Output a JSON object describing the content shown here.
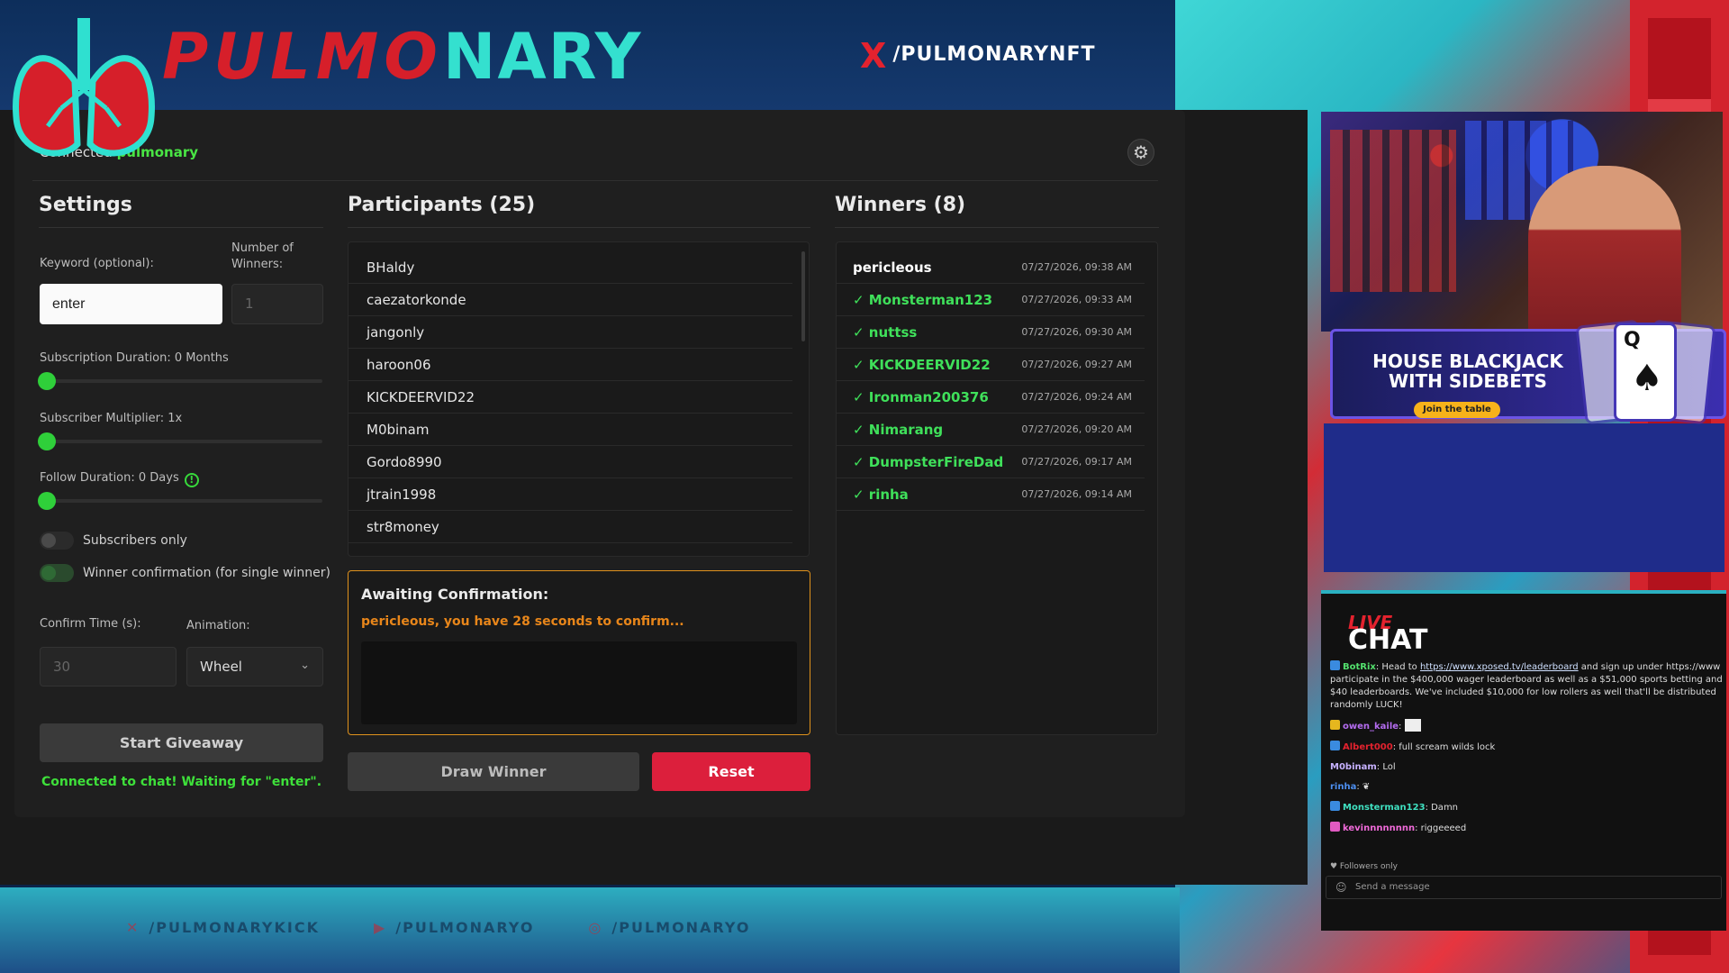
{
  "brand": {
    "part1": "PULMO",
    "part2": "NARY",
    "x_handle": "/PULMONARYNFT"
  },
  "socials": [
    "/PULMONARYKICK",
    "/PULMONARYO",
    "/PULMONARYO"
  ],
  "header": {
    "connected_label": "Connected",
    "channel_name": "pulmonary"
  },
  "settings": {
    "title": "Settings",
    "keyword_label": "Keyword (optional):",
    "keyword_value": "enter",
    "num_winners_label_1": "Number of",
    "num_winners_label_2": "Winners:",
    "num_winners_value": "1",
    "sub_duration_label": "Subscription Duration: 0 Months",
    "sub_multiplier_label": "Subscriber Multiplier: 1x",
    "follow_duration_label": "Follow Duration:  0  Days",
    "subscribers_only_label": "Subscribers only",
    "winner_confirmation_label": "Winner confirmation (for single winner)",
    "confirm_time_label": "Confirm Time (s):",
    "confirm_time_value": "30",
    "animation_label": "Animation:",
    "animation_value": "Wheel",
    "start_label": "Start Giveaway",
    "status_text": "Connected to chat! Waiting for \"enter\"."
  },
  "participants": {
    "title": "Participants (25)",
    "items": [
      "BHaldy",
      "caezatorkonde",
      "jangonly",
      "haroon06",
      "KICKDEERVID22",
      "M0binam",
      "Gordo8990",
      "jtrain1998",
      "str8money"
    ],
    "await_title": "Awaiting Confirmation:",
    "await_message": "pericleous, you have 28 seconds to confirm...",
    "draw_label": "Draw Winner",
    "reset_label": "Reset"
  },
  "winners": {
    "title": "Winners (8)",
    "items": [
      {
        "name": "pericleous",
        "time": "07/27/2026, 09:38 AM"
      },
      {
        "name": "✓ Monsterman123",
        "time": "07/27/2026, 09:33 AM"
      },
      {
        "name": "✓ nuttss",
        "time": "07/27/2026, 09:30 AM"
      },
      {
        "name": "✓ KICKDEERVID22",
        "time": "07/27/2026, 09:27 AM"
      },
      {
        "name": "✓ Ironman200376",
        "time": "07/27/2026, 09:24 AM"
      },
      {
        "name": "✓ Nimarang",
        "time": "07/27/2026, 09:20 AM"
      },
      {
        "name": "✓ DumpsterFireDad",
        "time": "07/27/2026, 09:17 AM"
      },
      {
        "name": "✓ rinha",
        "time": "07/27/2026, 09:14 AM"
      }
    ]
  },
  "promo": {
    "title": "HOUSE BLACKJACK WITH SIDEBETS",
    "button": "Join the table",
    "card_rank": "Q",
    "card_suit": "♠"
  },
  "chat": {
    "live": "LIVE",
    "chat": "CHAT",
    "m1_user": "BotRix",
    "m1_text_a": ": Head to ",
    "m1_link": "https://www.xposed.tv/leaderboard",
    "m1_text_b": " and sign up under https://www",
    "m1_text_c": "participate in the $400,000 wager leaderboard as well as a $51,000 sports betting and $40 leaderboards. We've included $10,000 for low rollers as well that'll be distributed randomly LUCK!",
    "m2_user": "owen_kaile",
    "m3_user": "Albert000",
    "m3_text": ": full scream wilds lock",
    "m4_user": "M0binam",
    "m4_text": ": Lol",
    "m5_user": "rinha",
    "m5_text": ":",
    "m6_user": "Monsterman123",
    "m6_text": ": Damn",
    "m7_user": "kevinnnnnnnn",
    "m7_text": ": riggeeeed",
    "followers_only": "♥ Followers only",
    "send_placeholder": "Send a message"
  }
}
